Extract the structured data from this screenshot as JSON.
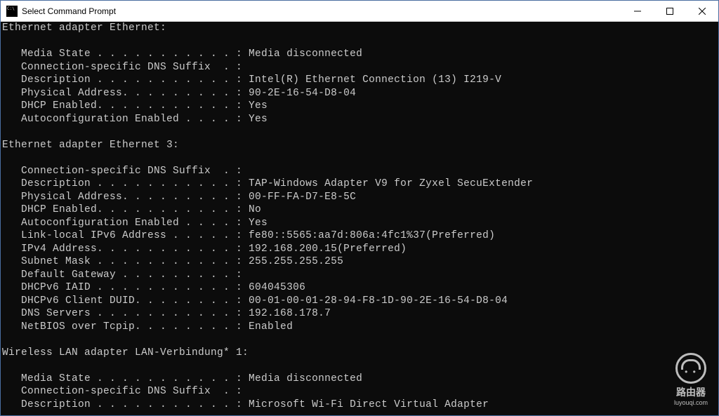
{
  "window": {
    "title": "Select Command Prompt"
  },
  "adapters": [
    {
      "header": "Ethernet adapter Ethernet:",
      "rows": [
        {
          "label": "Media State . . . . . . . . . . . :",
          "value": " Media disconnected"
        },
        {
          "label": "Connection-specific DNS Suffix  . :",
          "value": ""
        },
        {
          "label": "Description . . . . . . . . . . . :",
          "value": " Intel(R) Ethernet Connection (13) I219-V"
        },
        {
          "label": "Physical Address. . . . . . . . . :",
          "value": " 90-2E-16-54-D8-04"
        },
        {
          "label": "DHCP Enabled. . . . . . . . . . . :",
          "value": " Yes"
        },
        {
          "label": "Autoconfiguration Enabled . . . . :",
          "value": " Yes"
        }
      ]
    },
    {
      "header": "Ethernet adapter Ethernet 3:",
      "rows": [
        {
          "label": "Connection-specific DNS Suffix  . :",
          "value": ""
        },
        {
          "label": "Description . . . . . . . . . . . :",
          "value": " TAP-Windows Adapter V9 for Zyxel SecuExtender"
        },
        {
          "label": "Physical Address. . . . . . . . . :",
          "value": " 00-FF-FA-D7-E8-5C"
        },
        {
          "label": "DHCP Enabled. . . . . . . . . . . :",
          "value": " No"
        },
        {
          "label": "Autoconfiguration Enabled . . . . :",
          "value": " Yes"
        },
        {
          "label": "Link-local IPv6 Address . . . . . :",
          "value": " fe80::5565:aa7d:806a:4fc1%37(Preferred)"
        },
        {
          "label": "IPv4 Address. . . . . . . . . . . :",
          "value": " 192.168.200.15(Preferred)"
        },
        {
          "label": "Subnet Mask . . . . . . . . . . . :",
          "value": " 255.255.255.255"
        },
        {
          "label": "Default Gateway . . . . . . . . . :",
          "value": ""
        },
        {
          "label": "DHCPv6 IAID . . . . . . . . . . . :",
          "value": " 604045306"
        },
        {
          "label": "DHCPv6 Client DUID. . . . . . . . :",
          "value": " 00-01-00-01-28-94-F8-1D-90-2E-16-54-D8-04"
        },
        {
          "label": "DNS Servers . . . . . . . . . . . :",
          "value": " 192.168.178.7"
        },
        {
          "label": "NetBIOS over Tcpip. . . . . . . . :",
          "value": " Enabled"
        }
      ]
    },
    {
      "header": "Wireless LAN adapter LAN-Verbindung* 1:",
      "rows": [
        {
          "label": "Media State . . . . . . . . . . . :",
          "value": " Media disconnected"
        },
        {
          "label": "Connection-specific DNS Suffix  . :",
          "value": ""
        },
        {
          "label": "Description . . . . . . . . . . . :",
          "value": " Microsoft Wi-Fi Direct Virtual Adapter"
        }
      ]
    }
  ],
  "watermark": {
    "title": "路由器",
    "subtitle": "luyouqi.com"
  }
}
